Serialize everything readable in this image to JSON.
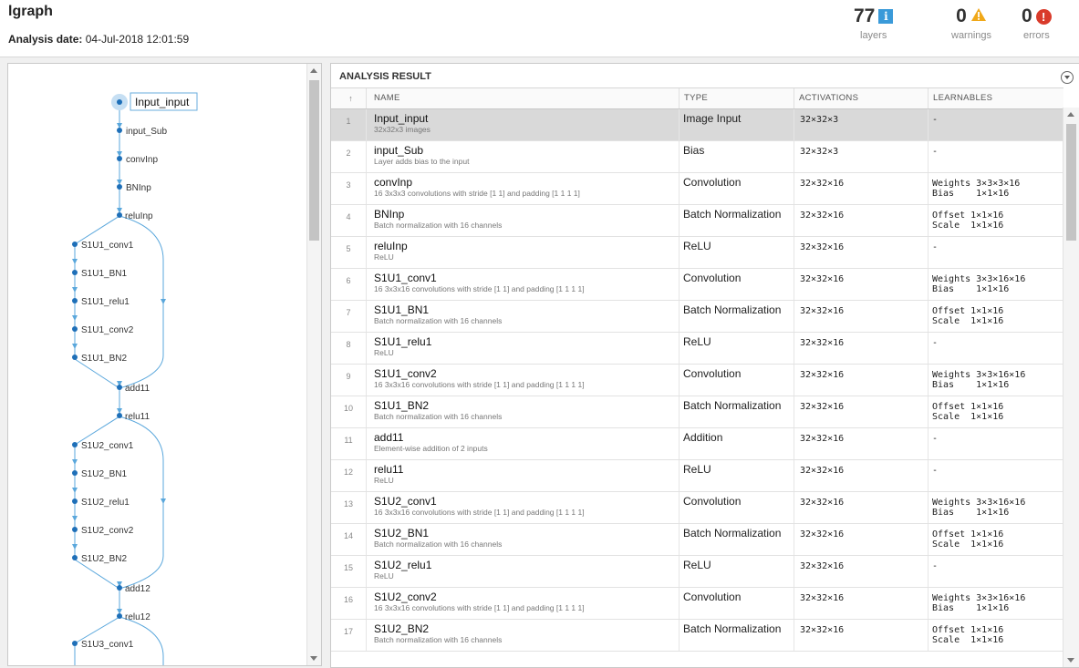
{
  "header": {
    "title": "lgraph",
    "date_label": "Analysis date:",
    "date_value": "04-Jul-2018 12:01:59",
    "stats": [
      {
        "value": "77",
        "label": "layers",
        "icon": "info-icon",
        "color": "#3a9ad9"
      },
      {
        "value": "0",
        "label": "warnings",
        "icon": "warning-icon",
        "color": "#f0a818"
      },
      {
        "value": "0",
        "label": "errors",
        "icon": "error-icon",
        "color": "#d93b2b"
      }
    ]
  },
  "graph": {
    "selected": "Input_input",
    "nodes": [
      "input_Sub",
      "convInp",
      "BNInp",
      "reluInp",
      "S1U1_conv1",
      "S1U1_BN1",
      "S1U1_relu1",
      "S1U1_conv2",
      "S1U1_BN2",
      "add11",
      "relu11",
      "S1U2_conv1",
      "S1U2_BN1",
      "S1U2_relu1",
      "S1U2_conv2",
      "S1U2_BN2",
      "add12",
      "relu12",
      "S1U3_conv1"
    ]
  },
  "result": {
    "title": "ANALYSIS RESULT",
    "columns": {
      "name": "NAME",
      "type": "TYPE",
      "activations": "ACTIVATIONS",
      "learnables": "LEARNABLES"
    },
    "rows": [
      {
        "num": "1",
        "name": "Input_input",
        "desc": "32x32x3 images",
        "type": "Image Input",
        "act": "32×32×3",
        "l1": "-",
        "l2": ""
      },
      {
        "num": "2",
        "name": "input_Sub",
        "desc": "Layer adds bias to the input",
        "type": "Bias",
        "act": "32×32×3",
        "l1": "-",
        "l2": ""
      },
      {
        "num": "3",
        "name": "convInp",
        "desc": "16 3x3x3 convolutions with stride [1 1] and padding [1 1 1 1]",
        "type": "Convolution",
        "act": "32×32×16",
        "l1": "Weights 3×3×3×16",
        "l2": "Bias    1×1×16"
      },
      {
        "num": "4",
        "name": "BNInp",
        "desc": "Batch normalization with 16 channels",
        "type": "Batch Normalization",
        "act": "32×32×16",
        "l1": "Offset 1×1×16",
        "l2": "Scale  1×1×16"
      },
      {
        "num": "5",
        "name": "reluInp",
        "desc": "ReLU",
        "type": "ReLU",
        "act": "32×32×16",
        "l1": "-",
        "l2": ""
      },
      {
        "num": "6",
        "name": "S1U1_conv1",
        "desc": "16 3x3x16 convolutions with stride [1 1] and padding [1 1 1 1]",
        "type": "Convolution",
        "act": "32×32×16",
        "l1": "Weights 3×3×16×16",
        "l2": "Bias    1×1×16"
      },
      {
        "num": "7",
        "name": "S1U1_BN1",
        "desc": "Batch normalization with 16 channels",
        "type": "Batch Normalization",
        "act": "32×32×16",
        "l1": "Offset 1×1×16",
        "l2": "Scale  1×1×16"
      },
      {
        "num": "8",
        "name": "S1U1_relu1",
        "desc": "ReLU",
        "type": "ReLU",
        "act": "32×32×16",
        "l1": "-",
        "l2": ""
      },
      {
        "num": "9",
        "name": "S1U1_conv2",
        "desc": "16 3x3x16 convolutions with stride [1 1] and padding [1 1 1 1]",
        "type": "Convolution",
        "act": "32×32×16",
        "l1": "Weights 3×3×16×16",
        "l2": "Bias    1×1×16"
      },
      {
        "num": "10",
        "name": "S1U1_BN2",
        "desc": "Batch normalization with 16 channels",
        "type": "Batch Normalization",
        "act": "32×32×16",
        "l1": "Offset 1×1×16",
        "l2": "Scale  1×1×16"
      },
      {
        "num": "11",
        "name": "add11",
        "desc": "Element-wise addition of 2 inputs",
        "type": "Addition",
        "act": "32×32×16",
        "l1": "-",
        "l2": ""
      },
      {
        "num": "12",
        "name": "relu11",
        "desc": "ReLU",
        "type": "ReLU",
        "act": "32×32×16",
        "l1": "-",
        "l2": ""
      },
      {
        "num": "13",
        "name": "S1U2_conv1",
        "desc": "16 3x3x16 convolutions with stride [1 1] and padding [1 1 1 1]",
        "type": "Convolution",
        "act": "32×32×16",
        "l1": "Weights 3×3×16×16",
        "l2": "Bias    1×1×16"
      },
      {
        "num": "14",
        "name": "S1U2_BN1",
        "desc": "Batch normalization with 16 channels",
        "type": "Batch Normalization",
        "act": "32×32×16",
        "l1": "Offset 1×1×16",
        "l2": "Scale  1×1×16"
      },
      {
        "num": "15",
        "name": "S1U2_relu1",
        "desc": "ReLU",
        "type": "ReLU",
        "act": "32×32×16",
        "l1": "-",
        "l2": ""
      },
      {
        "num": "16",
        "name": "S1U2_conv2",
        "desc": "16 3x3x16 convolutions with stride [1 1] and padding [1 1 1 1]",
        "type": "Convolution",
        "act": "32×32×16",
        "l1": "Weights 3×3×16×16",
        "l2": "Bias    1×1×16"
      },
      {
        "num": "17",
        "name": "S1U2_BN2",
        "desc": "Batch normalization with 16 channels",
        "type": "Batch Normalization",
        "act": "32×32×16",
        "l1": "Offset 1×1×16",
        "l2": "Scale  1×1×16"
      }
    ]
  }
}
